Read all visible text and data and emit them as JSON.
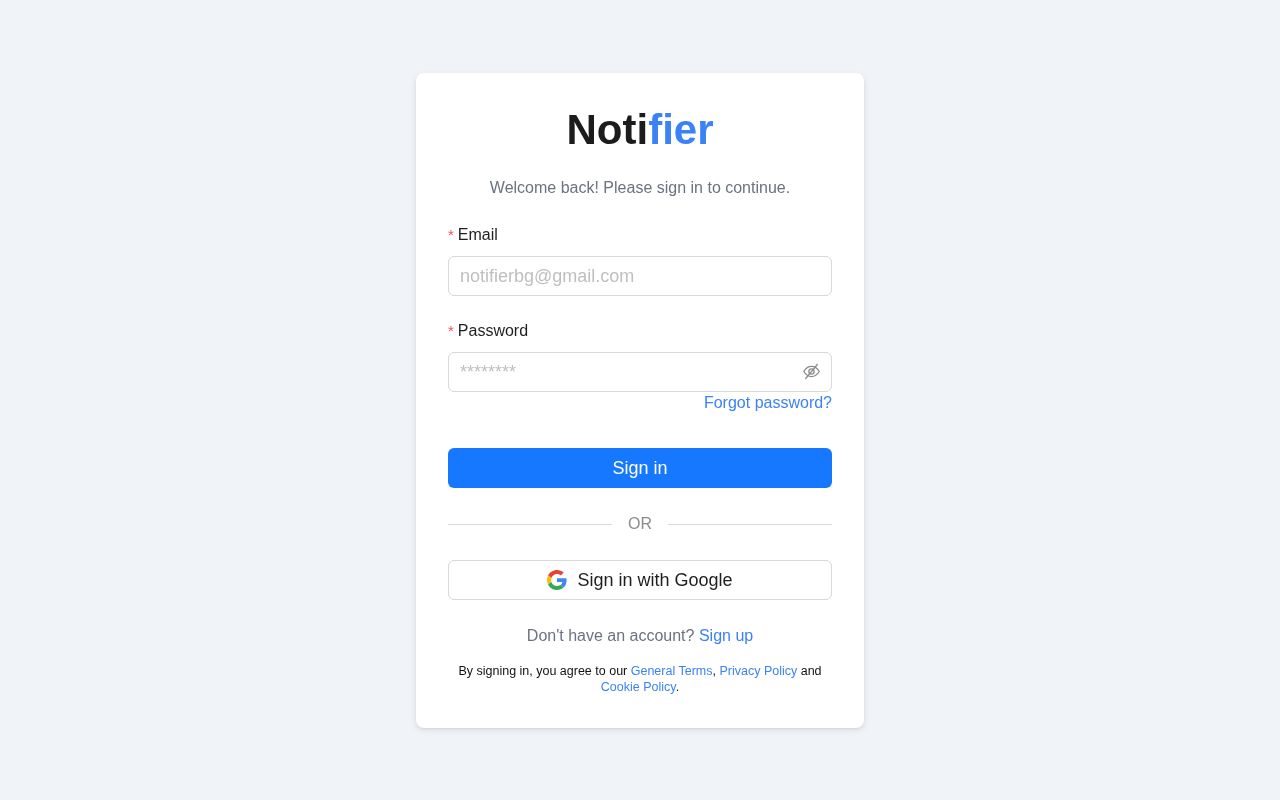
{
  "logo": {
    "parts": [
      {
        "text": "Noti",
        "accent": false
      },
      {
        "text": "fier",
        "accent": true
      }
    ]
  },
  "subtitle": "Welcome back! Please sign in to continue.",
  "fields": [
    {
      "kind": "email",
      "required_mark": "*",
      "label": "Email",
      "placeholder": "notifierbg@gmail.com"
    },
    {
      "kind": "password",
      "required_mark": "*",
      "label": "Password",
      "placeholder": "********"
    }
  ],
  "forgot_link": "Forgot password?",
  "sign_in_button": "Sign in",
  "divider": "OR",
  "google_button": "Sign in with Google",
  "signup": {
    "prompt": "Don't have an account?",
    "link": "Sign up"
  },
  "terms": [
    {
      "kind": "text",
      "text": "By signing in, you agree to our "
    },
    {
      "kind": "link",
      "text": "General Terms"
    },
    {
      "kind": "text",
      "text": ", "
    },
    {
      "kind": "link",
      "text": "Privacy Policy"
    },
    {
      "kind": "text",
      "text": " and "
    },
    {
      "kind": "link",
      "text": "Cookie Policy"
    },
    {
      "kind": "text",
      "text": "."
    }
  ]
}
